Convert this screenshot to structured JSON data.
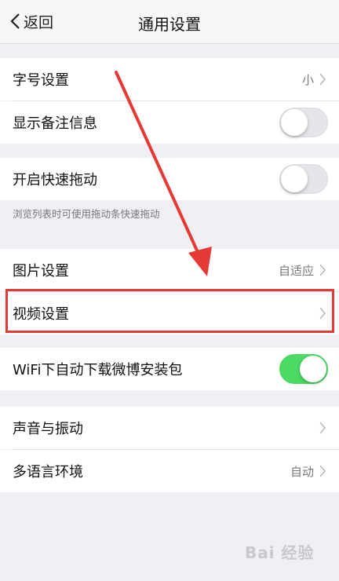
{
  "nav": {
    "back_label": "返回",
    "title": "通用设置"
  },
  "rows": {
    "font_size": {
      "label": "字号设置",
      "value": "小"
    },
    "show_remark": {
      "label": "显示备注信息",
      "toggle": "off"
    },
    "quick_drag": {
      "label": "开启快速拖动",
      "toggle": "off"
    },
    "quick_drag_hint": "浏览列表时可使用拖动条快速拖动",
    "image_settings": {
      "label": "图片设置",
      "value": "自适应"
    },
    "video_settings": {
      "label": "视频设置"
    },
    "wifi_download": {
      "label": "WiFi下自动下载微博安装包",
      "toggle": "on"
    },
    "sound_vibration": {
      "label": "声音与振动"
    },
    "language": {
      "label": "多语言环境",
      "value": "自动"
    }
  },
  "watermark": "Bai 经验",
  "colors": {
    "toggle_on": "#4cd964",
    "highlight": "#e53935",
    "background": "#efeff4"
  }
}
